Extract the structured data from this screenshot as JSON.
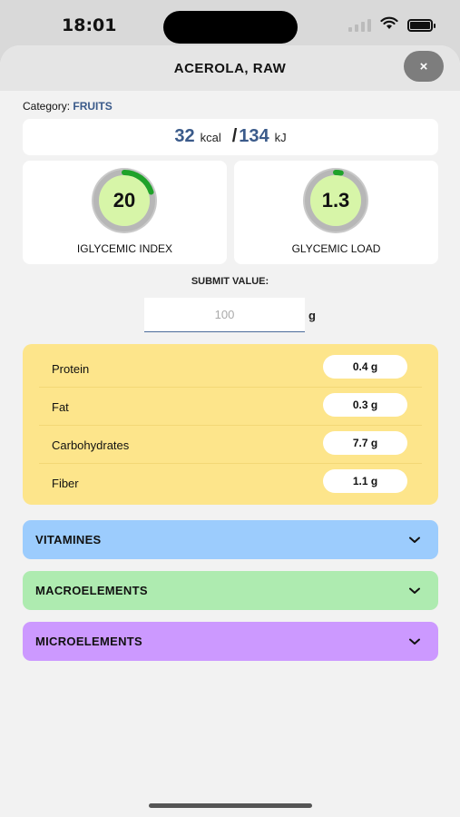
{
  "status_bar": {
    "time": "18:01"
  },
  "header": {
    "title": "ACEROLA, RAW",
    "close_label": "×"
  },
  "category": {
    "label": "Category:",
    "value": "FRUITS"
  },
  "energy": {
    "kcal": "32",
    "kcal_unit": "kcal",
    "separator": "/",
    "kj": "134",
    "kj_unit": "kJ"
  },
  "glycemic": {
    "index": {
      "value": "20",
      "label": "IGLYCEMIC INDEX",
      "fraction": 0.2
    },
    "load": {
      "value": "1.3",
      "label": "GLYCEMIC LOAD",
      "fraction": 0.03
    }
  },
  "submit": {
    "label": "SUBMIT VALUE:",
    "placeholder": "100",
    "unit": "g"
  },
  "nutrients": [
    {
      "name": "Protein",
      "value": "0.4 g"
    },
    {
      "name": "Fat",
      "value": "0.3 g"
    },
    {
      "name": "Carbohydrates",
      "value": "7.7 g"
    },
    {
      "name": "Fiber",
      "value": "1.1 g"
    }
  ],
  "sections": {
    "vitamines": "VITAMINES",
    "macroelements": "MACROELEMENTS",
    "microelements": "MICROELEMENTS"
  },
  "colors": {
    "accent": "#3a5a8a",
    "gauge_green": "#1fa22a",
    "gauge_fill": "#d7f5a8",
    "nutrients_bg": "#fde58b",
    "vitamines_bg": "#9cccfd",
    "macro_bg": "#aeebb0",
    "micro_bg": "#cc99ff"
  }
}
